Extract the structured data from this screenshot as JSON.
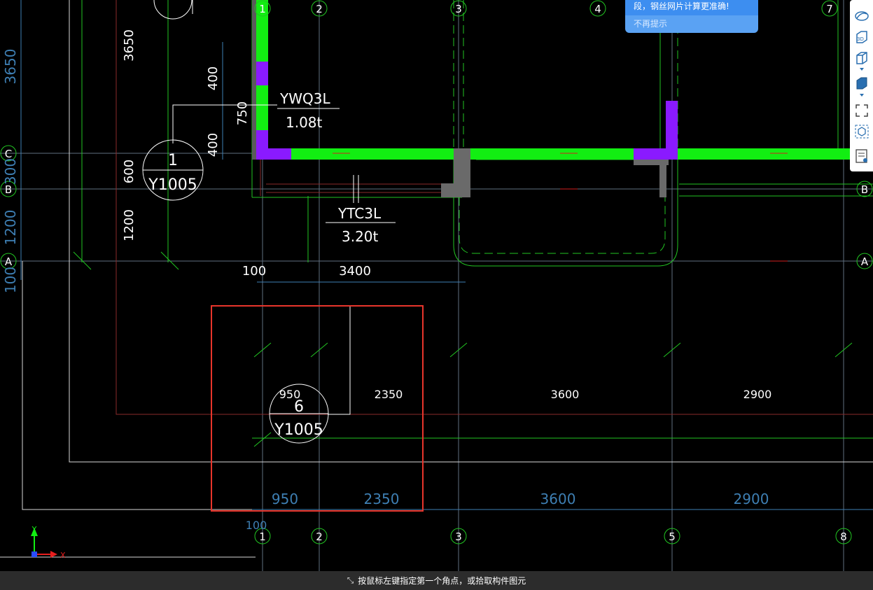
{
  "tooltip": {
    "message": "段，钢丝网片计算更准确!",
    "dismiss": "不再提示"
  },
  "status_bar": {
    "prompt": "按鼠标左键指定第一个角点，或拾取构件图元"
  },
  "axes": {
    "top": [
      "1",
      "2",
      "3",
      "4",
      "7"
    ],
    "bottom": [
      "1",
      "2",
      "3",
      "5",
      "8"
    ],
    "left": [
      "C",
      "B",
      "A"
    ],
    "right": [
      "B",
      "A"
    ]
  },
  "dimensions": {
    "left_blue": [
      "3650",
      "300",
      "1200",
      "100"
    ],
    "left_white": [
      "3650",
      "600",
      "1200"
    ],
    "vertical_small": [
      "400",
      "750",
      "400"
    ],
    "horizontal_white_top": [
      "100",
      "3400"
    ],
    "horizontal_white_mid": [
      "950",
      "2350",
      "3600",
      "2900"
    ],
    "horizontal_blue_bottom": [
      "950",
      "2350",
      "3600",
      "2900"
    ],
    "bottom_small": "100"
  },
  "labels": {
    "wall_name": "YWQ3L",
    "wall_weight": "1.08t",
    "beam_name": "YTC3L",
    "beam_weight": "3.20t",
    "detail_1_num": "1",
    "detail_1_ref": "Y1005",
    "detail_6_num": "6",
    "detail_6_ref": "Y1005"
  },
  "ucs": {
    "y": "Y",
    "x": "X"
  },
  "colors": {
    "wall_green": "#12ee12",
    "wall_purple": "#8a1aff",
    "axis_green": "#22c522",
    "dim_blue": "#3e7fb3",
    "selection_red": "#e8352b"
  }
}
